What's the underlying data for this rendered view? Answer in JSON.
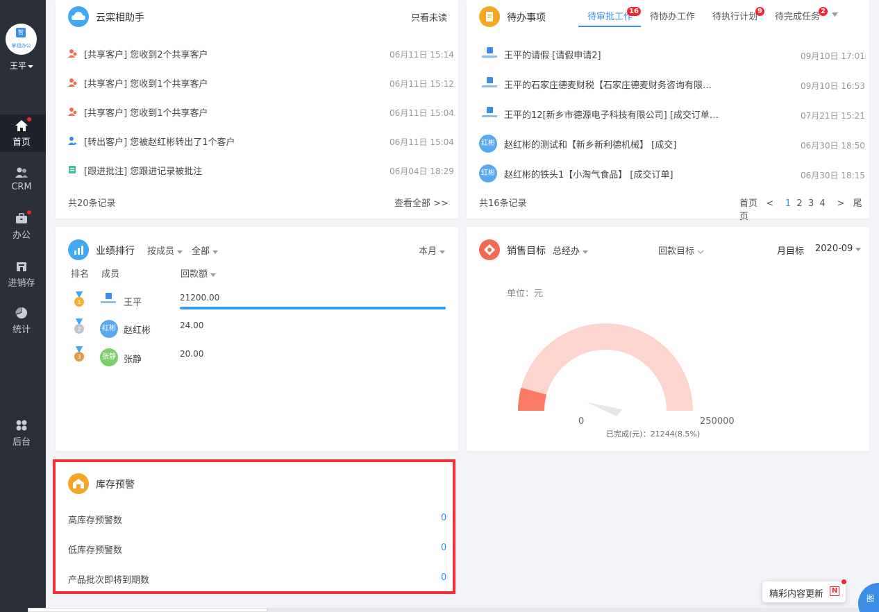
{
  "sidebar": {
    "user": "王平",
    "avatar_brand": "智",
    "avatar_text": "掌相办公",
    "items": [
      {
        "label": "首页",
        "icon": "home-icon"
      },
      {
        "label": "CRM",
        "icon": "users-icon"
      },
      {
        "label": "办公",
        "icon": "briefcase-icon"
      },
      {
        "label": "进销存",
        "icon": "warehouse-icon"
      },
      {
        "label": "统计",
        "icon": "pie-chart-icon"
      },
      {
        "label": "后台",
        "icon": "grid-icon"
      }
    ]
  },
  "assistant": {
    "title": "云寀相助手",
    "filter": "只看未读",
    "items": [
      {
        "text": "[共享客户] 您收到2个共享客户",
        "time": "06月11日 15:14",
        "icon": "share-customer-icon"
      },
      {
        "text": "[共享客户] 您收到1个共享客户",
        "time": "06月11日 15:12",
        "icon": "share-customer-icon"
      },
      {
        "text": "[共享客户] 您收到1个共享客户",
        "time": "06月11日 15:04",
        "icon": "share-customer-icon"
      },
      {
        "text": "[转出客户] 您被赵红彬转出了1个客户",
        "time": "06月11日 15:04",
        "icon": "transfer-customer-icon"
      },
      {
        "text": "[跟进批注] 您跟进记录被批注",
        "time": "06月04日 18:29",
        "icon": "annotation-icon"
      }
    ],
    "total": "共20条记录",
    "view_all": "查看全部 >>"
  },
  "todo": {
    "title": "待办事项",
    "tabs": [
      {
        "label": "待审批工作",
        "badge": "16"
      },
      {
        "label": "待协办工作",
        "badge": ""
      },
      {
        "label": "待执行计划",
        "badge": "9"
      },
      {
        "label": "待完成任务",
        "badge": "2"
      }
    ],
    "items": [
      {
        "text": "王平的请假 [请假申请2]",
        "time": "09月10日 17:01",
        "avatar": ""
      },
      {
        "text": "王平的石家庄德麦财税【石家庄德麦财务咨询有限…",
        "time": "09月10日 16:53",
        "avatar": ""
      },
      {
        "text": "王平的12[新乡市德源电子科技有限公司] [成交订单…",
        "time": "07月21日 15:21",
        "avatar": ""
      },
      {
        "text": "赵红彬的测试和【新乡新利德机械】 [成交]",
        "time": "06月30日 18:50",
        "avatar": "红彬"
      },
      {
        "text": "赵红彬的铁头1【小淘气食品】 [成交订单]",
        "time": "06月30日 18:15",
        "avatar": "红彬"
      }
    ],
    "total": "共16条记录",
    "pager": {
      "first": "首页",
      "prev": "<",
      "pages": [
        "1",
        "2",
        "3",
        "4"
      ],
      "next": ">",
      "last": "尾页"
    }
  },
  "ranking": {
    "title": "业绩排行",
    "by": "按成员",
    "scope": "全部",
    "period": "本月",
    "col_rank": "排名",
    "col_member": "成员",
    "col_amount": "回款额",
    "rows": [
      {
        "name": "王平",
        "amount": "21200.00",
        "avatar": "",
        "medal": "gold",
        "progress": 1.0
      },
      {
        "name": "赵红彬",
        "amount": "24.00",
        "avatar": "红彬",
        "medal": "silver",
        "progress": 0.0
      },
      {
        "name": "张静",
        "amount": "20.00",
        "avatar": "张静",
        "medal": "bronze",
        "progress": 0.0
      }
    ]
  },
  "sales_target": {
    "title": "销售目标",
    "dept": "总经办",
    "target_type": "回款目标",
    "period_type": "月目标",
    "month": "2020-09",
    "unit": "单位：元",
    "gauge_min": "0",
    "gauge_max": "250000",
    "completed_label": "已完成(元)：21244(8.5%)",
    "completed_ratio": 0.085,
    "colors": {
      "track": "#fdd5ce",
      "fill": "#fa7a64",
      "pointer": "#e6e6e6"
    }
  },
  "stock_alert": {
    "title": "库存预警",
    "rows": [
      {
        "label": "高库存预警数",
        "value": "0"
      },
      {
        "label": "低库存预警数",
        "value": "0"
      },
      {
        "label": "产品批次即将到期数",
        "value": "0"
      }
    ]
  },
  "floating": {
    "update_label": "精彩内容更新",
    "update_mark": "N",
    "corner_label": "图"
  }
}
